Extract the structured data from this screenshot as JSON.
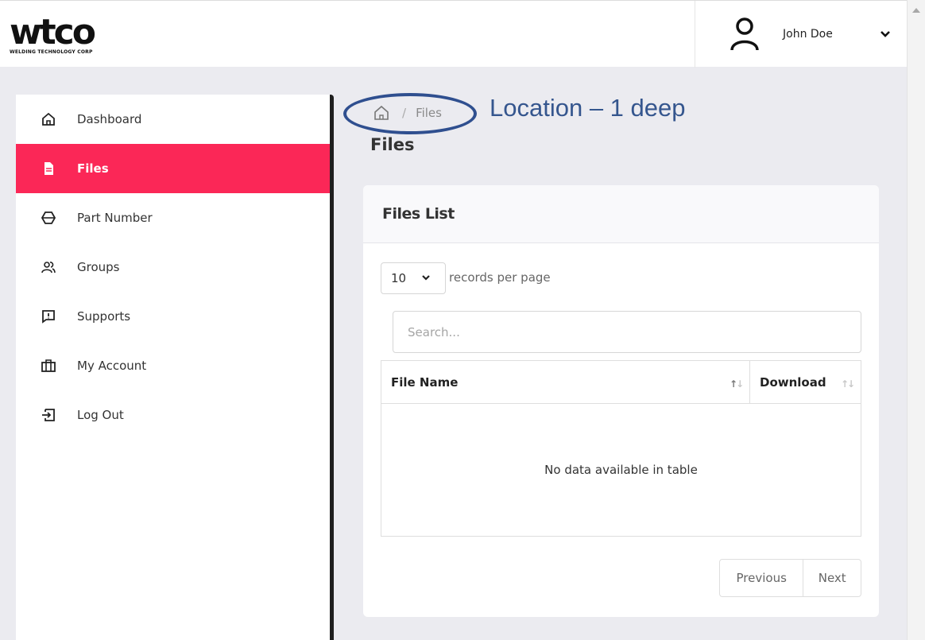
{
  "header": {
    "logo_text": "wtco",
    "logo_subtitle": "WELDING TECHNOLOGY CORP",
    "user_name": "John Doe"
  },
  "sidebar": {
    "items": [
      {
        "label": "Dashboard",
        "icon": "home-icon",
        "active": false
      },
      {
        "label": "Files",
        "icon": "file-icon",
        "active": true
      },
      {
        "label": "Part Number",
        "icon": "part-icon",
        "active": false
      },
      {
        "label": "Groups",
        "icon": "users-icon",
        "active": false
      },
      {
        "label": "Supports",
        "icon": "message-alert-icon",
        "active": false
      },
      {
        "label": "My Account",
        "icon": "briefcase-icon",
        "active": false
      },
      {
        "label": "Log Out",
        "icon": "logout-icon",
        "active": false
      }
    ]
  },
  "breadcrumb": {
    "home_icon": "home-icon",
    "separator": "/",
    "current": "Files"
  },
  "annotation": {
    "text": "Location – 1 deep",
    "color": "#35568e"
  },
  "page": {
    "title": "Files"
  },
  "card": {
    "title": "Files List",
    "page_length": "10",
    "records_label": "records per page",
    "search_placeholder": "Search...",
    "table": {
      "columns": [
        "File Name",
        "Download"
      ],
      "empty_text": "No data available in table"
    },
    "pagination": {
      "previous": "Previous",
      "next": "Next"
    }
  },
  "colors": {
    "accent": "#fb2757",
    "sidebar_border": "#1e1e1e",
    "background": "#ebebf0"
  }
}
